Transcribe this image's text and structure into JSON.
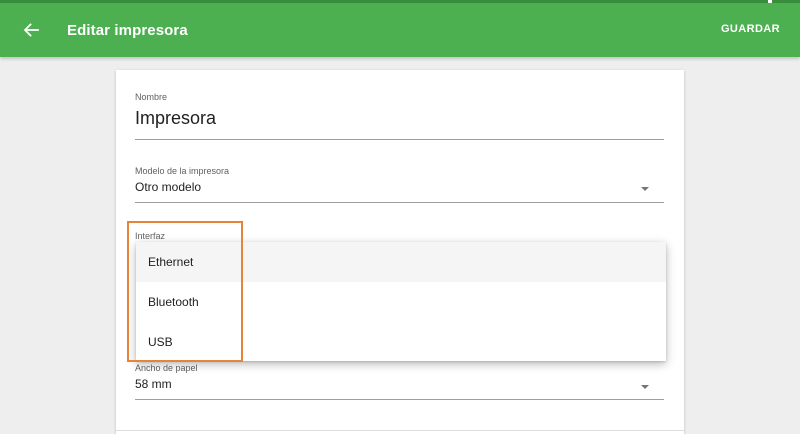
{
  "toolbar": {
    "title": "Editar impresora",
    "save_label": "GUARDAR",
    "back_icon": "arrow-back-icon",
    "color": "#4caf50"
  },
  "form": {
    "name": {
      "label": "Nombre",
      "value": "Impresora"
    },
    "model": {
      "label": "Modelo de la impresora",
      "value": "Otro modelo"
    },
    "interface": {
      "label": "Interfaz",
      "options": [
        "Ethernet",
        "Bluetooth",
        "USB"
      ],
      "highlighted_option": "Ethernet"
    },
    "paper_width": {
      "label": "Ancho de papel",
      "value": "58 mm"
    }
  },
  "annotation": {
    "color": "#e8833a"
  }
}
